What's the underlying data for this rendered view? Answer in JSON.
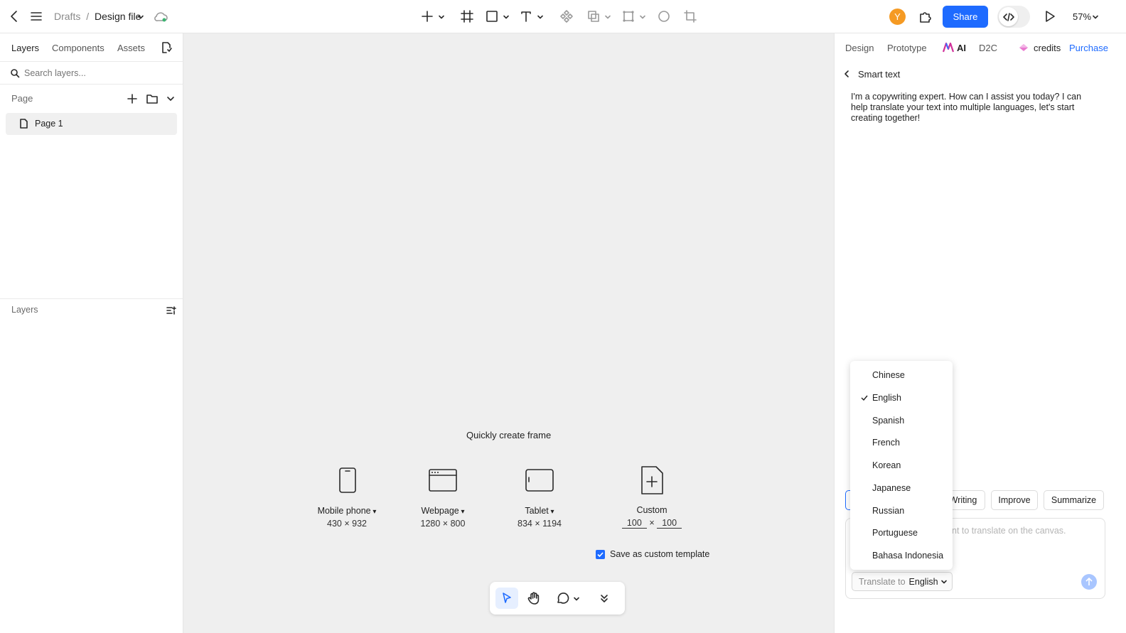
{
  "topbar": {
    "breadcrumb_root": "Drafts",
    "breadcrumb_sep": "/",
    "file_name": "Design file",
    "avatar_initial": "Y",
    "share_label": "Share",
    "zoom": "57%"
  },
  "left": {
    "tabs": [
      "Layers",
      "Components",
      "Assets"
    ],
    "search_placeholder": "Search layers...",
    "page_heading": "Page",
    "page_item": "Page 1",
    "layers_heading": "Layers"
  },
  "canvas": {
    "quick_title": "Quickly create frame",
    "frames": [
      {
        "label": "Mobile phone",
        "dims": "430 × 932"
      },
      {
        "label": "Webpage",
        "dims": "1280 × 800"
      },
      {
        "label": "Tablet",
        "dims": "834 × 1194"
      },
      {
        "label": "Custom",
        "w": "100",
        "x": "×",
        "h": "100"
      }
    ],
    "save_template": "Save as custom template"
  },
  "right": {
    "tabs": [
      "Design",
      "Prototype",
      "AI",
      "D2C"
    ],
    "credits": "credits",
    "purchase": "Purchase",
    "section_title": "Smart text",
    "ai_message": "I'm a copywriting expert. How can I assist you today? I can help translate your text into multiple languages, let's start creating together!",
    "chips": [
      "Writing",
      "Improve",
      "Summarize"
    ],
    "input_placeholder": "nt to translate on the canvas.",
    "translate_label": "Translate to",
    "translate_value": "English"
  },
  "dropdown": {
    "options": [
      "Chinese",
      "English",
      "Spanish",
      "French",
      "Korean",
      "Japanese",
      "Russian",
      "Portuguese",
      "Bahasa Indonesia"
    ],
    "selected": "English"
  },
  "colors": {
    "accent": "#1e6bff",
    "avatar": "#f59a23",
    "canvas_bg": "#efefef"
  }
}
